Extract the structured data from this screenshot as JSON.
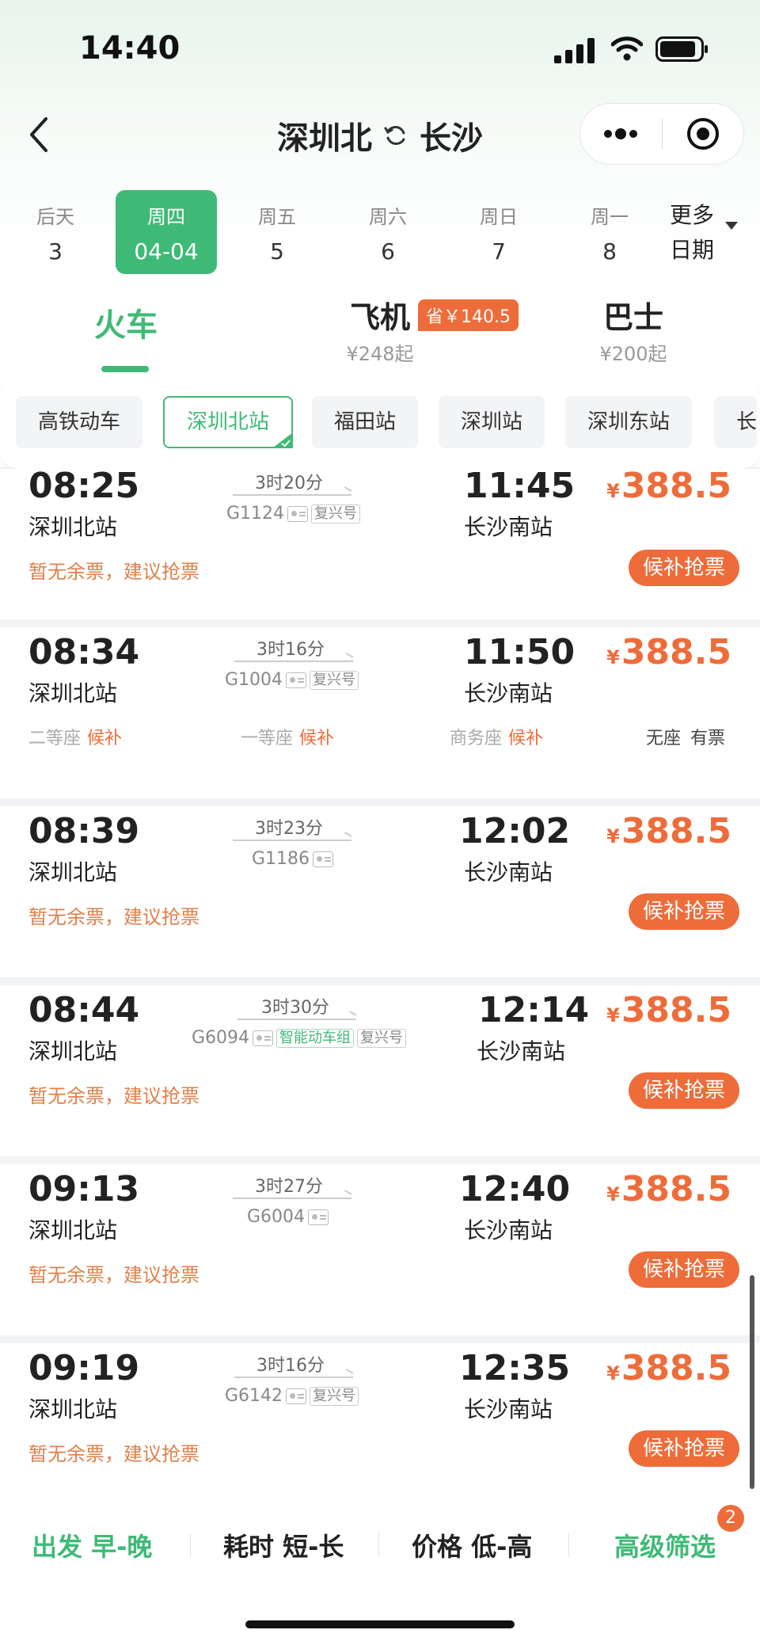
{
  "status_bar": {
    "time": "14:40"
  },
  "header": {
    "from": "深圳北",
    "to": "长沙"
  },
  "colors": {
    "accent": "#3fba76",
    "price": "#ee6c3a"
  },
  "dates": [
    {
      "week": "后天",
      "day": "3"
    },
    {
      "week": "周四",
      "day": "04-04",
      "selected": true
    },
    {
      "week": "周五",
      "day": "5"
    },
    {
      "week": "周六",
      "day": "6"
    },
    {
      "week": "周日",
      "day": "7"
    },
    {
      "week": "周一",
      "day": "8"
    }
  ],
  "more_dates": {
    "line1": "更多",
    "line2": "日期"
  },
  "transport_tabs": [
    {
      "label": "火车",
      "active": true
    },
    {
      "label": "飞机",
      "price": "¥248起",
      "badge": "省￥140.5"
    },
    {
      "label": "巴士",
      "price": "¥200起"
    }
  ],
  "station_chips": [
    {
      "label": "高铁动车"
    },
    {
      "label": "深圳北站",
      "active": true
    },
    {
      "label": "福田站"
    },
    {
      "label": "深圳站"
    },
    {
      "label": "深圳东站"
    },
    {
      "label": "长"
    }
  ],
  "trains": [
    {
      "dep_time": "08:25",
      "dep_station": "深圳北站",
      "duration": "3时20分",
      "code": "G1124",
      "tags": [
        "复兴号"
      ],
      "arr_time": "11:45",
      "arr_station": "长沙南站",
      "price": "388.5",
      "note": "暂无余票，建议抢票",
      "button": "候补抢票"
    },
    {
      "dep_time": "08:34",
      "dep_station": "深圳北站",
      "duration": "3时16分",
      "code": "G1004",
      "tags": [
        "复兴号"
      ],
      "arr_time": "11:50",
      "arr_station": "长沙南站",
      "price": "388.5",
      "seats": [
        {
          "name": "二等座",
          "status": "候补"
        },
        {
          "name": "一等座",
          "status": "候补"
        },
        {
          "name": "商务座",
          "status": "候补"
        },
        {
          "name": "无座",
          "status": "有票"
        }
      ]
    },
    {
      "dep_time": "08:39",
      "dep_station": "深圳北站",
      "duration": "3时23分",
      "code": "G1186",
      "tags": [],
      "arr_time": "12:02",
      "arr_station": "长沙南站",
      "price": "388.5",
      "note": "暂无余票，建议抢票",
      "button": "候补抢票"
    },
    {
      "dep_time": "08:44",
      "dep_station": "深圳北站",
      "duration": "3时30分",
      "code": "G6094",
      "tags": [
        "智能动车组",
        "复兴号"
      ],
      "arr_time": "12:14",
      "arr_station": "长沙南站",
      "price": "388.5",
      "note": "暂无余票，建议抢票",
      "button": "候补抢票"
    },
    {
      "dep_time": "09:13",
      "dep_station": "深圳北站",
      "duration": "3时27分",
      "code": "G6004",
      "tags": [],
      "arr_time": "12:40",
      "arr_station": "长沙南站",
      "price": "388.5",
      "note": "暂无余票，建议抢票",
      "button": "候补抢票"
    },
    {
      "dep_time": "09:19",
      "dep_station": "深圳北站",
      "duration": "3时16分",
      "code": "G6142",
      "tags": [
        "复兴号"
      ],
      "arr_time": "12:35",
      "arr_station": "长沙南站",
      "price": "388.5",
      "note": "暂无余票，建议抢票",
      "button": "候补抢票"
    }
  ],
  "currency_symbol": "¥",
  "bottom_bar": {
    "depart": "出发 早-晚",
    "duration": "耗时 短-长",
    "price": "价格 低-高",
    "filter": "高级筛选",
    "filter_count": "2"
  }
}
